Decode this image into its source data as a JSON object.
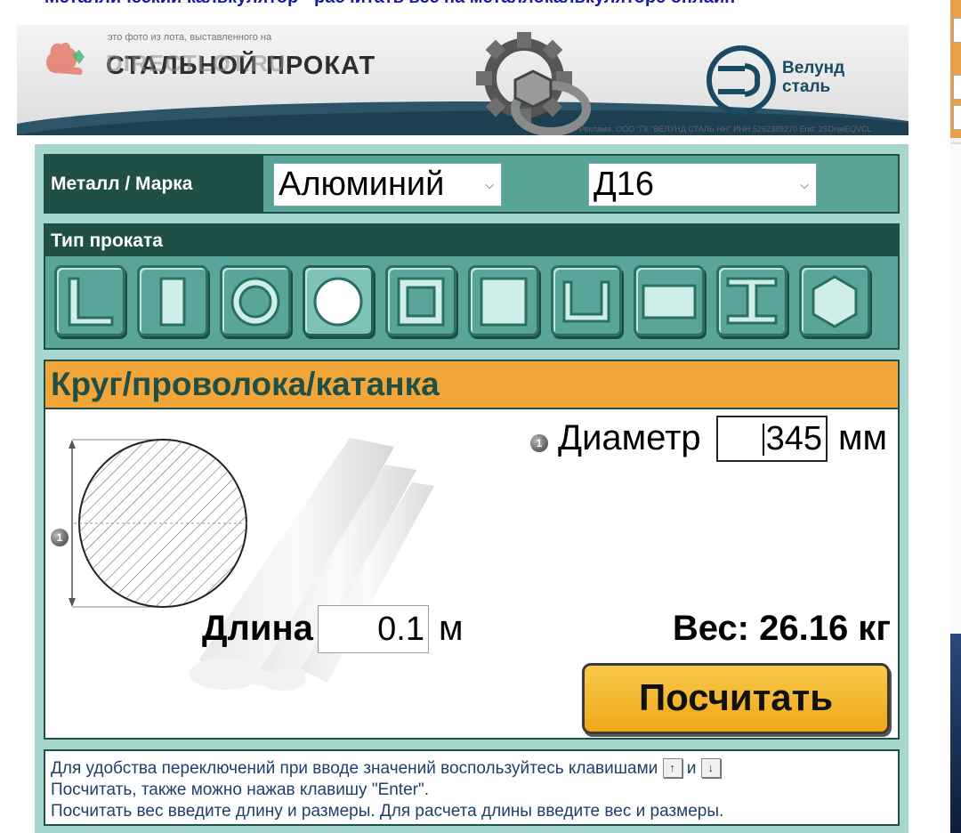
{
  "page": {
    "heading": "Металлический калькулятор - расчитать вес на металлокалькуляторе онлайн"
  },
  "banner": {
    "caption": "это фото из лота, выставленного на",
    "brand": "СТАЛЬНОЙ ПРОКАТ",
    "watermark": "DIRECTLOT.RU",
    "partner_line1": "Велунд",
    "partner_line2": "сталь",
    "ad_text": "Реклама. ООО \"ГК \"ВЕЛУНД СТАЛЬ НН\" ИНН 5262389270 Erid: 2SDnjeEQVCL"
  },
  "metal": {
    "label": "Металл / Марка",
    "metal_value": "Алюминий",
    "grade_value": "Д16"
  },
  "profile_type": {
    "label": "Тип проката",
    "tiles": [
      {
        "icon": "angle-icon"
      },
      {
        "icon": "strip-icon"
      },
      {
        "icon": "pipe-icon"
      },
      {
        "icon": "round-bar-icon",
        "selected": true
      },
      {
        "icon": "square-pipe-icon"
      },
      {
        "icon": "square-bar-icon"
      },
      {
        "icon": "channel-icon"
      },
      {
        "icon": "sheet-icon"
      },
      {
        "icon": "i-beam-icon"
      },
      {
        "icon": "hexagon-icon"
      }
    ]
  },
  "panel": {
    "title": "Круг/проволока/катанка",
    "bullet": "1",
    "diameter_label": "Диаметр",
    "diameter_value": "345",
    "diameter_unit": "мм",
    "length_label": "Длина",
    "length_value": "0.1",
    "length_unit": "м",
    "weight_text": "Вес: 26.16 кг",
    "calculate_label": "Посчитать"
  },
  "help": {
    "line1_prefix": "Для удобства переключений при вводе значений воспользуйтесь клавишами",
    "key_up": "↑",
    "conj": "и",
    "key_down": "↓",
    "line2": "Посчитать, также можно нажав клавишу \"Enter\".",
    "line3": "Посчитать вес введите длину и размеры. Для расчета длины введите вес и размеры."
  },
  "colors": {
    "dark_green": "#1f4f46",
    "teal": "#5aa599",
    "panel_bg": "#a7d6ce",
    "orange": "#f2a63a",
    "button": "#f0b02a"
  }
}
